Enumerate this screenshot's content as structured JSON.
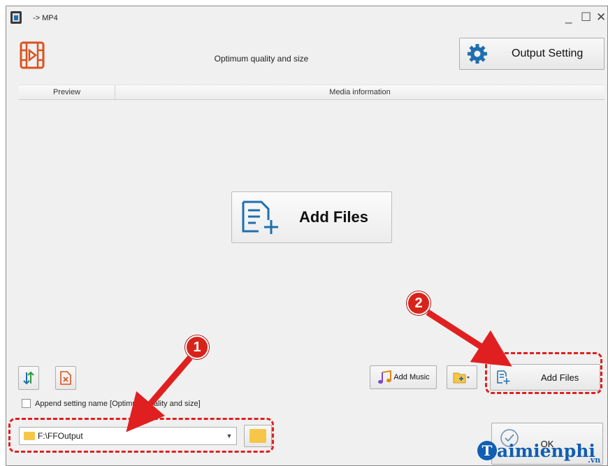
{
  "window": {
    "title": "-> MP4"
  },
  "header": {
    "quality_text": "Optimum quality and size",
    "output_setting_label": "Output Setting"
  },
  "table": {
    "columns": [
      "Preview",
      "Media information"
    ]
  },
  "main": {
    "add_files_big_label": "Add Files"
  },
  "toolbar": {
    "add_music_label": "Add Music",
    "add_files_label": "Add Files"
  },
  "options": {
    "append_setting_name": "Append setting name [Optimum quality and size]",
    "append_checked": false
  },
  "output": {
    "path": "F:\\FFOutput",
    "ok_label": "OK"
  },
  "annotations": {
    "badge1": "1",
    "badge2": "2",
    "highlight_color": "#e02020"
  },
  "watermark": {
    "text": "aimienphi",
    "initial": "T",
    "suffix": ".vn"
  },
  "colors": {
    "window_bg": "#f0f0f0",
    "accent_blue": "#1e6fb0",
    "film_orange": "#d9531e",
    "folder_yellow": "#f6c64a",
    "badge_red": "#d8231a"
  }
}
